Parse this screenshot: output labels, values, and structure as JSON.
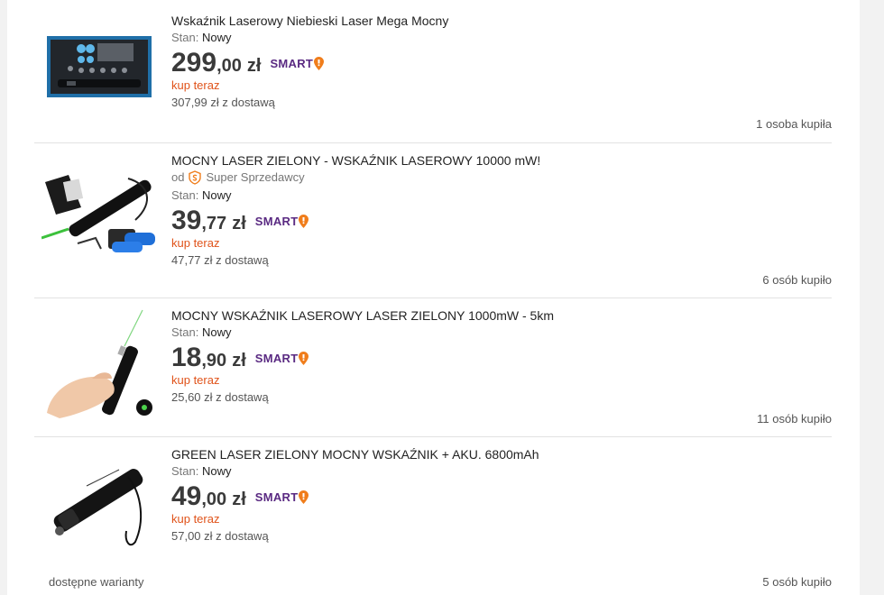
{
  "listings": [
    {
      "title": "Wskaźnik Laserowy Niebieski Laser Mega Mocny",
      "condition_label": "Stan:",
      "condition_value": "Nowy",
      "price_int": "299",
      "price_dec": ",00",
      "currency": "zł",
      "badge": "SMART",
      "buy_label": "kup teraz",
      "delivery": "307,99 zł z dostawą",
      "bought": "1 osoba kupiła",
      "image_icon": "blue-laser-kit-image"
    },
    {
      "title": "MOCNY LASER ZIELONY - WSKAŹNIK LASEROWY 10000 mW!",
      "seller_prefix": "od",
      "seller": "Super Sprzedawcy",
      "condition_label": "Stan:",
      "condition_value": "Nowy",
      "price_int": "39",
      "price_dec": ",77",
      "currency": "zł",
      "badge": "SMART",
      "buy_label": "kup teraz",
      "delivery": "47,77 zł z dostawą",
      "bought": "6 osób kupiło",
      "image_icon": "green-laser-set-image"
    },
    {
      "title": "MOCNY WSKAŹNIK LASEROWY LASER ZIELONY 1000mW - 5km",
      "condition_label": "Stan:",
      "condition_value": "Nowy",
      "price_int": "18",
      "price_dec": ",90",
      "currency": "zł",
      "badge": "SMART",
      "buy_label": "kup teraz",
      "delivery": "25,60 zł z dostawą",
      "bought": "11 osób kupiło",
      "image_icon": "hand-laser-pointer-image"
    },
    {
      "title": "GREEN LASER ZIELONY MOCNY WSKAŹNIK + AKU. 6800mAh",
      "condition_label": "Stan:",
      "condition_value": "Nowy",
      "price_int": "49",
      "price_dec": ",00",
      "currency": "zł",
      "badge": "SMART",
      "buy_label": "kup teraz",
      "delivery": "57,00 zł z dostawą",
      "bought": "5 osób kupiło",
      "image_icon": "tactical-laser-image"
    }
  ],
  "variants_label": "dostępne warianty",
  "colors": {
    "buy_now": "#e0531a",
    "smart_text": "#5a2a82",
    "smart_pin": "#f07d1b",
    "price": "#3a3a3a"
  }
}
